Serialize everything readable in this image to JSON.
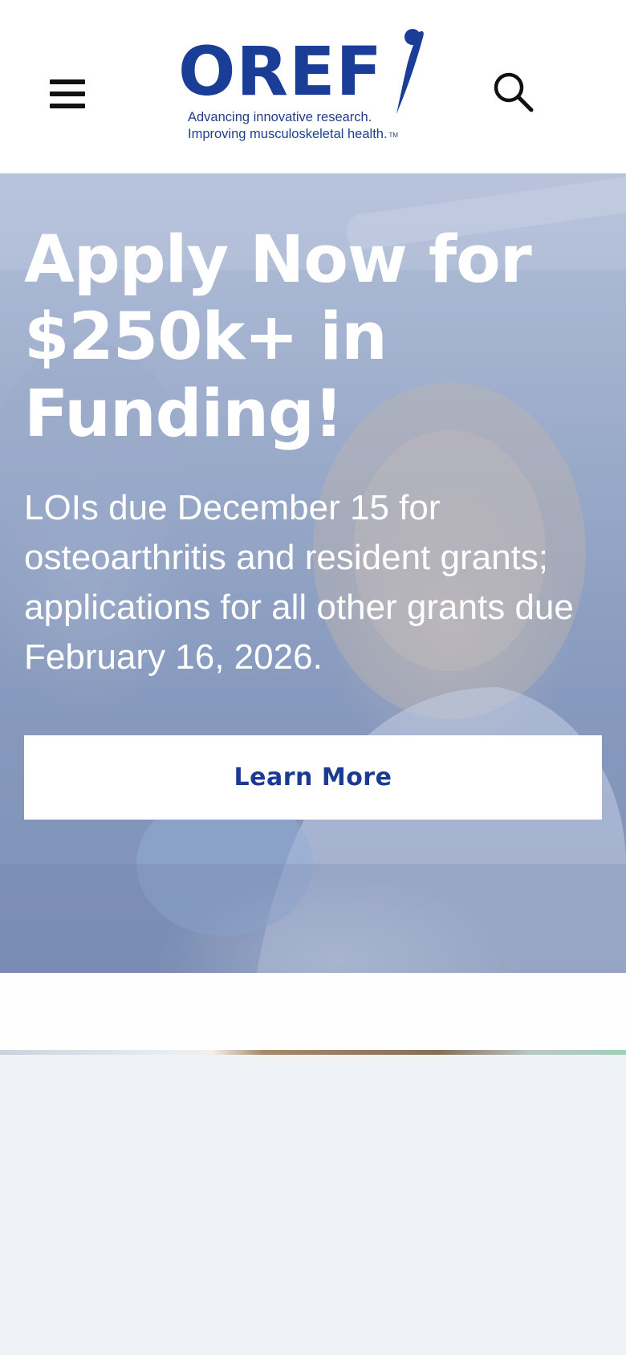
{
  "header": {
    "menu_icon": "hamburger-menu-icon",
    "search_icon": "search-icon",
    "logo": {
      "wordmark": "OREF",
      "tagline_line1": "Advancing innovative research.",
      "tagline_line2": "Improving musculoskeletal health.",
      "trademark": "TM",
      "brand_color": "#1a3d97"
    }
  },
  "hero": {
    "title": "Apply Now for $250k+ in Funding!",
    "subtitle": "LOIs due December 15 for osteoarthritis and resident grants; applications for all other grants due February 16, 2026.",
    "cta_label": "Learn More",
    "cta_text_color": "#1b3a94"
  },
  "colors": {
    "background": "#ffffff",
    "lower_panel": "#eff3f7",
    "hero_overlay": "#7f93b6"
  }
}
